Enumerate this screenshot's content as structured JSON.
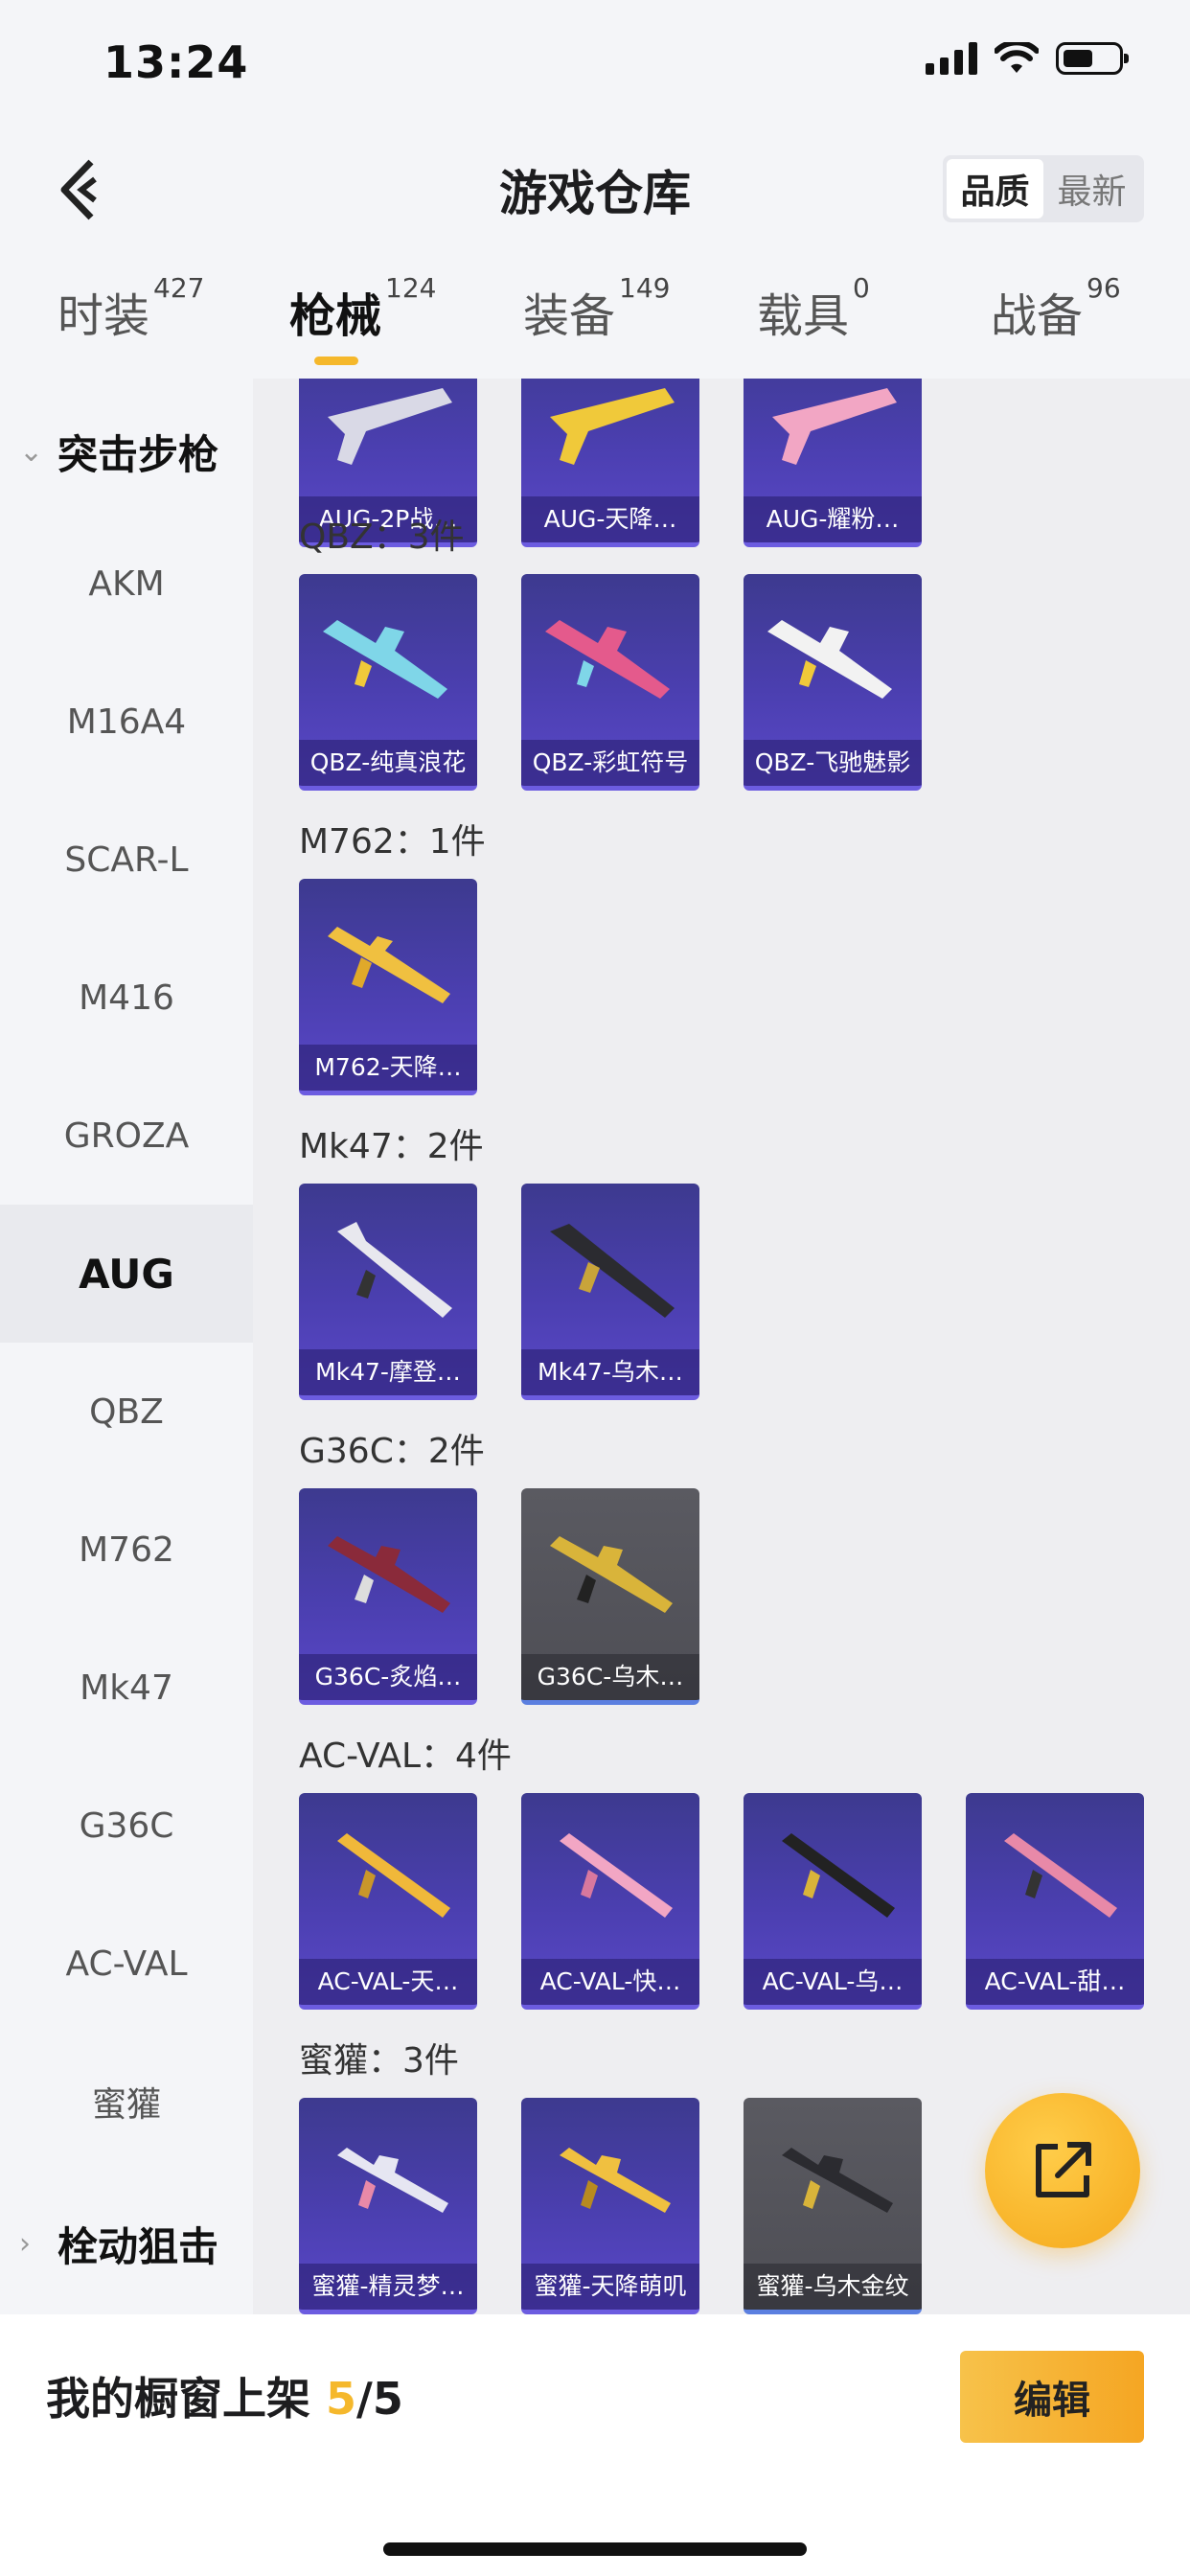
{
  "status": {
    "time": "13:24"
  },
  "header": {
    "title": "游戏仓库",
    "sort_options": [
      "品质",
      "最新"
    ],
    "sort_active": "品质"
  },
  "tabs": [
    {
      "label": "时装",
      "count": "427"
    },
    {
      "label": "枪械",
      "count": "124"
    },
    {
      "label": "装备",
      "count": "149"
    },
    {
      "label": "载具",
      "count": "0"
    },
    {
      "label": "战备",
      "count": "96"
    }
  ],
  "sidebar": {
    "category": "突击步枪",
    "items": [
      "AKM",
      "M16A4",
      "SCAR-L",
      "M416",
      "GROZA",
      "AUG",
      "QBZ",
      "M762",
      "Mk47",
      "G36C",
      "AC-VAL",
      "蜜獾"
    ],
    "active": "AUG",
    "next_category": "栓动狙击"
  },
  "groups": [
    {
      "title": "",
      "items": [
        "AUG-2P战…",
        "AUG-天降…",
        "AUG-耀粉…"
      ]
    },
    {
      "title": "QBZ：3件",
      "items": [
        "QBZ-纯真浪花",
        "QBZ-彩虹符号",
        "QBZ-飞驰魅影"
      ]
    },
    {
      "title": "M762：1件",
      "items": [
        "M762-天降…"
      ]
    },
    {
      "title": "Mk47：2件",
      "items": [
        "Mk47-摩登…",
        "Mk47-乌木…"
      ]
    },
    {
      "title": "G36C：2件",
      "items": [
        "G36C-炙焰…",
        "G36C-乌木…"
      ]
    },
    {
      "title": "AC-VAL：4件",
      "items": [
        "AC-VAL-天…",
        "AC-VAL-快…",
        "AC-VAL-乌…",
        "AC-VAL-甜…"
      ]
    },
    {
      "title": "蜜獾：3件",
      "items": [
        "蜜獾-精灵梦…",
        "蜜獾-天降萌叽",
        "蜜獾-乌木金纹"
      ]
    }
  ],
  "bottom": {
    "shelf_label": "我的橱窗上架",
    "shelf_current": "5",
    "shelf_total": "/5",
    "edit_label": "编辑"
  },
  "colors": {
    "accent": "#f5b82c",
    "card_purple": "#4b3fb0",
    "card_gray": "#55555c"
  }
}
